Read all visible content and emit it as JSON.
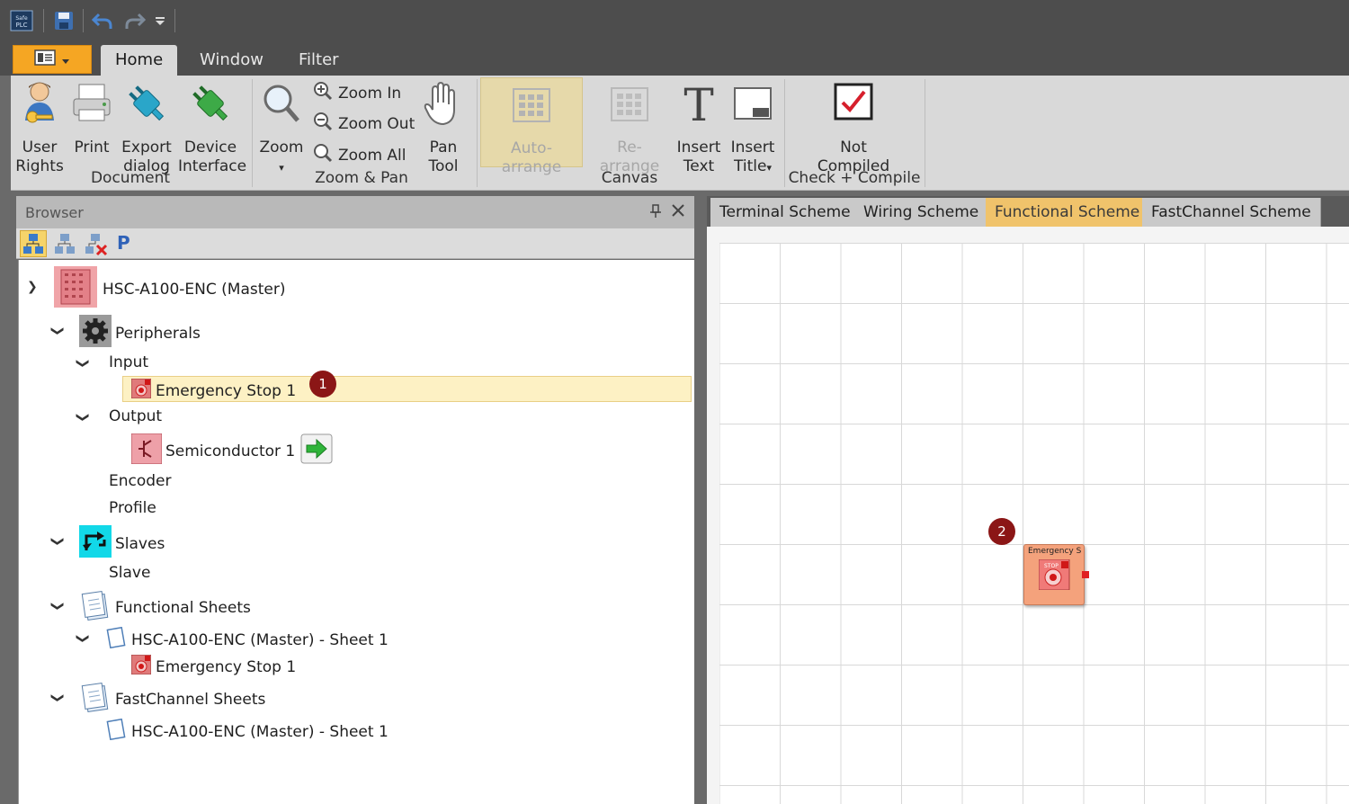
{
  "quick_access": {
    "app_logo": "softplc-logo-icon",
    "items": [
      "save-icon",
      "undo-icon",
      "redo-icon",
      "customize-dropdown-icon"
    ]
  },
  "ribbon_tabs": [
    {
      "label": "Home",
      "active": true
    },
    {
      "label": "Window",
      "active": false
    },
    {
      "label": "Filter",
      "active": false
    }
  ],
  "ribbon": {
    "document": {
      "label": "Document",
      "user_rights": "User Rights",
      "user_rights_line1": "User",
      "user_rights_line2": "Rights",
      "print": "Print",
      "export_line1": "Export",
      "export_line2": "dialog",
      "device_line1": "Device",
      "device_line2": "Interface"
    },
    "zoom_pan": {
      "label": "Zoom & Pan",
      "zoom": "Zoom",
      "zoom_in": "Zoom In",
      "zoom_out": "Zoom Out",
      "zoom_all": "Zoom All",
      "pan_line1": "Pan",
      "pan_line2": "Tool"
    },
    "canvas": {
      "label": "Canvas",
      "auto_arrange": "Auto-arrange",
      "re_arrange": "Re-arrange",
      "insert_text_line1": "Insert",
      "insert_text_line2": "Text",
      "insert_title_line1": "Insert",
      "insert_title_line2": "Title"
    },
    "check_compile": {
      "label": "Check + Compile",
      "status_line1": "Not",
      "status_line2": "Compiled"
    }
  },
  "browser": {
    "title": "Browser",
    "tree": {
      "master": "HSC-A100-ENC (Master)",
      "peripherals": "Peripherals",
      "input": "Input",
      "emergency_stop": "Emergency Stop 1",
      "output": "Output",
      "semiconductor": "Semiconductor 1",
      "encoder": "Encoder",
      "profile": "Profile",
      "slaves": "Slaves",
      "slave": "Slave",
      "functional_sheets": "Functional Sheets",
      "func_sheet1": "HSC-A100-ENC (Master) - Sheet 1",
      "func_sheet1_item": "Emergency Stop 1",
      "fastchannel_sheets": "FastChannel Sheets",
      "fc_sheet1": "HSC-A100-ENC (Master) - Sheet 1"
    }
  },
  "scheme_tabs": [
    {
      "label": "Terminal Scheme",
      "active": false
    },
    {
      "label": "Wiring Scheme",
      "active": false
    },
    {
      "label": "Functional Scheme",
      "active": true
    },
    {
      "label": "FastChannel Scheme",
      "active": false
    }
  ],
  "canvas": {
    "block_label": "Emergency S"
  },
  "markers": {
    "m1": "1",
    "m2": "2"
  },
  "colors": {
    "app_button": "#f5a623",
    "active_scheme_tab": "#f0c36b",
    "selection": "#fdf1c4",
    "marker": "#8b1616",
    "block": "#f4a27c"
  }
}
